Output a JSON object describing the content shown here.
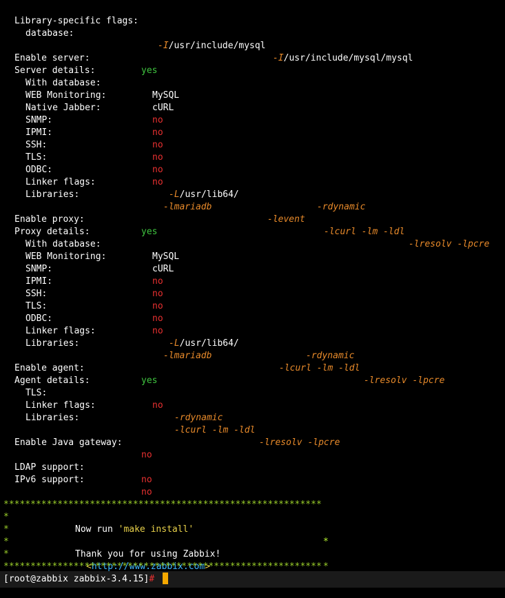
{
  "lib_flags": {
    "label": "Library-specific flags:",
    "db_label": "database:",
    "v1": "-I",
    "v1_path": "/usr/include/mysql",
    "v2": "-I",
    "v2_path": "/usr/include/mysql/mysql"
  },
  "server": {
    "enable_label": "Enable server:",
    "enable_value": "yes",
    "details_label": "Server details:",
    "with_db_label": "With database:",
    "with_db": "MySQL",
    "web_label": "WEB Monitoring:",
    "web": "cURL",
    "jabber_label": "Native Jabber:",
    "jabber": "no",
    "snmp_label": "SNMP:",
    "snmp": "no",
    "ipmi_label": "IPMI:",
    "ipmi": "no",
    "ssh_label": "SSH:",
    "ssh": "no",
    "tls_label": "TLS:",
    "tls": "no",
    "odbc_label": "ODBC:",
    "odbc": "no",
    "linker_label": "Linker flags:",
    "linker_flag": "-L",
    "linker_path": "/usr/lib64/",
    "linker_rd": "-rdynamic",
    "libs_label": "Libraries:",
    "lib1": "-lmariadb",
    "lib2": "-levent",
    "lib3": "-lcurl -lm -ldl",
    "lib4": "-lresolv -lpcre"
  },
  "proxy": {
    "enable_label": "Enable proxy:",
    "enable_value": "yes",
    "details_label": "Proxy details:",
    "with_db_label": "With database:",
    "with_db": "MySQL",
    "web_label": "WEB Monitoring:",
    "web": "cURL",
    "snmp_label": "SNMP:",
    "snmp": "no",
    "ipmi_label": "IPMI:",
    "ipmi": "no",
    "ssh_label": "SSH:",
    "ssh": "no",
    "tls_label": "TLS:",
    "tls": "no",
    "odbc_label": "ODBC:",
    "odbc": "no",
    "linker_label": "Linker flags:",
    "linker_flag": "-L",
    "linker_path": "/usr/lib64/",
    "linker_rd": "-rdynamic",
    "libs_label": "Libraries:",
    "lib1": "-lmariadb",
    "lib3": "-lcurl -lm -ldl",
    "lib4": "-lresolv -lpcre"
  },
  "agent": {
    "enable_label": "Enable agent:",
    "enable_value": "yes",
    "details_label": "Agent details:",
    "tls_label": "TLS:",
    "tls": "no",
    "linker_label": "Linker flags:",
    "linker_rd": "-rdynamic",
    "libs_label": "Libraries:",
    "lib3": "-lcurl -lm -ldl",
    "lib4": "-lresolv -lpcre"
  },
  "java": {
    "label": "Enable Java gateway:",
    "value": "no"
  },
  "ldap": {
    "label": "LDAP support:",
    "value": "no"
  },
  "ipv6": {
    "label": "IPv6 support:",
    "value": "no"
  },
  "banner": {
    "stars": "***********************************************************",
    "edge": "*",
    "now_run": "Now run ",
    "cmd": "'make install'",
    "thanks": "Thank you for using Zabbix!",
    "lt": "<",
    "url": "http://www.zabbix.com",
    "gt": ">"
  },
  "prompt": {
    "text": "[root@zabbix zabbix-3.4.15]",
    "hash": "#"
  }
}
